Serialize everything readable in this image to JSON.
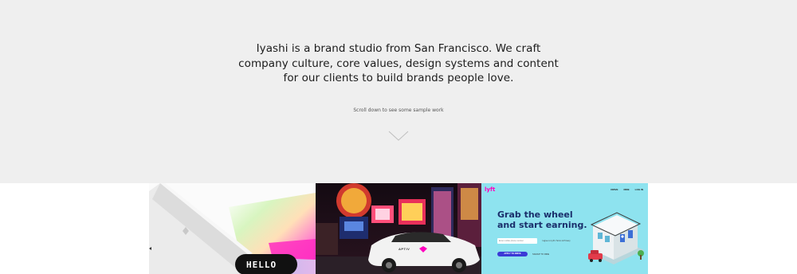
{
  "hero": {
    "intro_lines": [
      "Iyashi is a brand studio from San Francisco. We craft",
      "company culture, core values, design systems and content",
      "for our clients to build brands people love."
    ],
    "scroll_hint": "Scroll down to see some sample work",
    "scroll_icon": "chevron-down-icon"
  },
  "gallery": {
    "tiles": [
      {
        "name": "laptop-gradient-hello",
        "display_text": "HELLO"
      },
      {
        "name": "las-vegas-lyft-car",
        "car_badge": "APTIV"
      },
      {
        "name": "lyft-driver-signup",
        "logo": "lyft",
        "nav": [
          "DRIVE",
          "RIDE",
          "LOG IN"
        ],
        "headline": [
          "Grab the wheel",
          "and start earning."
        ],
        "phone_placeholder": "Enter mobile phone number",
        "terms_text": "I agree to Lyft's Terms & Privacy",
        "apply_button": "APPLY TO DRIVE",
        "signup_link": "SIGNUP TO RIDE"
      }
    ]
  },
  "colors": {
    "hero_bg": "#efefef",
    "text": "#1c1c1c",
    "lyft_pink": "#ff00bf",
    "lyft_sky": "#8ee3ef",
    "lyft_navy": "#1a2f6b",
    "apply_purple": "#3b3ad6"
  }
}
